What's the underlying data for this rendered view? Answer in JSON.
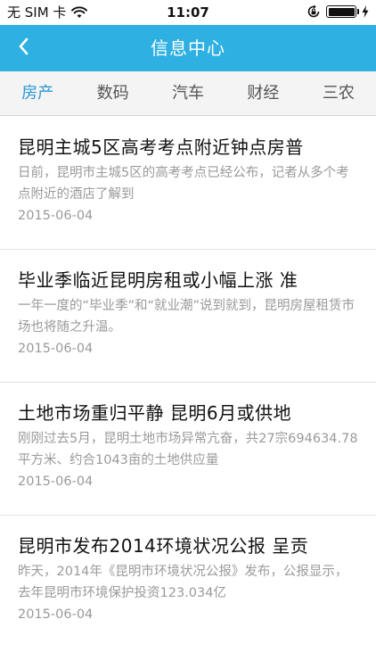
{
  "status_bar": {
    "carrier": "无 SIM 卡",
    "time": "11:07"
  },
  "nav": {
    "title": "信息中心",
    "back_label": "<"
  },
  "tabs": [
    {
      "label": "房产",
      "active": true
    },
    {
      "label": "数码",
      "active": false
    },
    {
      "label": "汽车",
      "active": false
    },
    {
      "label": "财经",
      "active": false
    },
    {
      "label": "三农",
      "active": false
    }
  ],
  "news": [
    {
      "title": "昆明主城5区高考考点附近钟点房普",
      "summary": "日前，昆明市主城5区的高考考点已经公布，记者从多个考点附近的酒店了解到",
      "date": "2015-06-04"
    },
    {
      "title": "毕业季临近昆明房租或小幅上涨 准",
      "summary": "一年一度的“毕业季”和“就业潮”说到就到，昆明房屋租赁市场也将随之升温。",
      "date": "2015-06-04"
    },
    {
      "title": "土地市场重归平静 昆明6月或供地",
      "summary": "刚刚过去5月，昆明土地市场异常亢奋，共27宗694634.78平方米、约合1043亩的土地供应量",
      "date": "2015-06-04"
    },
    {
      "title": "昆明市发布2014环境状况公报 呈贡",
      "summary": "昨天，2014年《昆明市环境状况公报》发布，公报显示，去年昆明市环境保护投资123.034亿",
      "date": "2015-06-04"
    }
  ],
  "colors": {
    "nav_bg": "#2fb0e2",
    "tab_active": "#2a97d6",
    "muted_text": "#9a9a9a"
  }
}
